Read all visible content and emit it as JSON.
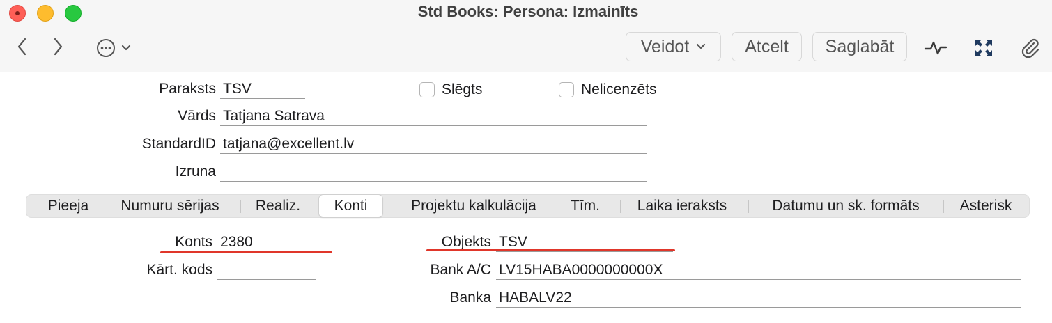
{
  "window": {
    "title": "Std Books: Persona: Izmainīts"
  },
  "toolbar": {
    "back_icon": "chevron-left-icon",
    "forward_icon": "chevron-right-icon",
    "more_icon": "ellipsis-circle-icon",
    "create_label": "Veidot",
    "cancel_label": "Atcelt",
    "save_label": "Saglabāt",
    "activity_icon": "pulse-icon",
    "fullscreen_icon": "expand-icon",
    "attach_icon": "paperclip-icon"
  },
  "header": {
    "signature_label": "Paraksts",
    "signature_value": "TSV",
    "name_label": "Vārds",
    "name_value": "Tatjana Satrava",
    "standardid_label": "StandardID",
    "standardid_value": "tatjana@excellent.lv",
    "pronunciation_label": "Izruna",
    "pronunciation_value": "",
    "closed_label": "Slēgts",
    "closed_checked": false,
    "unlicensed_label": "Nelicenzēts",
    "unlicensed_checked": false
  },
  "tabs": [
    {
      "label": "Pieeja",
      "active": false
    },
    {
      "label": "Numuru sērijas",
      "active": false
    },
    {
      "label": "Realiz.",
      "active": false
    },
    {
      "label": "Konti",
      "active": true
    },
    {
      "label": "Projektu kalkulācija",
      "active": false
    },
    {
      "label": "Tīm.",
      "active": false
    },
    {
      "label": "Laika ieraksts",
      "active": false
    },
    {
      "label": "Datumu un sk. formāts",
      "active": false
    },
    {
      "label": "Asterisk",
      "active": false
    }
  ],
  "konti": {
    "account_label": "Konts",
    "account_value": "2380",
    "card_code_label": "Kārt. kods",
    "card_code_value": "",
    "object_label": "Objekts",
    "object_value": "TSV",
    "bank_ac_label": "Bank A/C",
    "bank_ac_value": "LV15HABA0000000000X",
    "bank_label": "Banka",
    "bank_value": "HABALV22"
  },
  "colors": {
    "highlight": "#e0362a",
    "close": "#fe5f57",
    "minimize": "#febc2e",
    "maximize": "#28c840"
  }
}
